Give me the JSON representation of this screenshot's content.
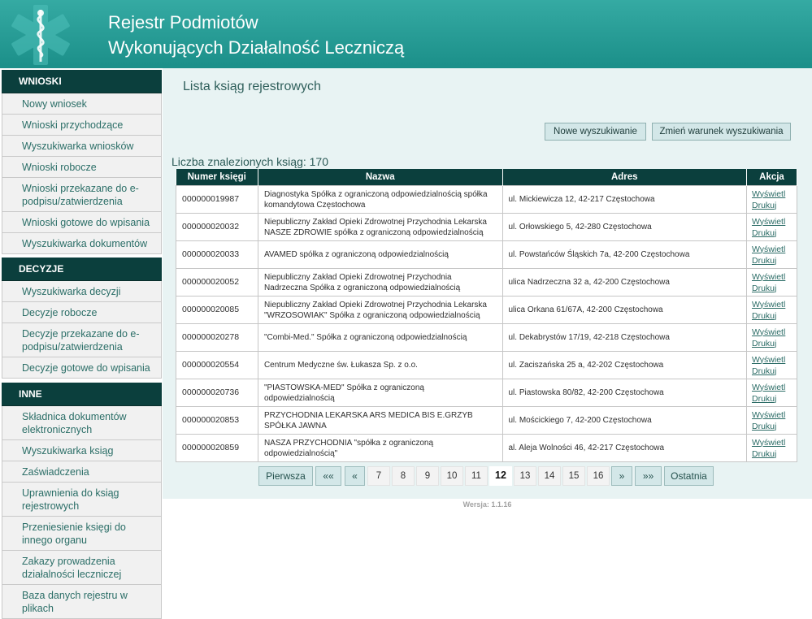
{
  "header": {
    "title_line1": "Rejestr Podmiotów",
    "title_line2": "Wykonujących Działalność Leczniczą"
  },
  "sidebar": {
    "sections": [
      {
        "title": "WNIOSKI",
        "items": [
          "Nowy wniosek",
          "Wnioski przychodzące",
          "Wyszukiwarka wniosków",
          "Wnioski robocze",
          "Wnioski przekazane do e-podpisu/zatwierdzenia",
          "Wnioski gotowe do wpisania",
          "Wyszukiwarka dokumentów"
        ]
      },
      {
        "title": "DECYZJE",
        "items": [
          "Wyszukiwarka decyzji",
          "Decyzje robocze",
          "Decyzje przekazane do e-podpisu/zatwierdzenia",
          "Decyzje gotowe do wpisania"
        ]
      },
      {
        "title": "INNE",
        "items": [
          "Składnica dokumentów elektronicznych",
          "Wyszukiwarka ksiąg",
          "Zaświadczenia",
          "Uprawnienia do ksiąg rejestrowych",
          "Przeniesienie księgi do innego organu",
          "Zakazy prowadzenia działalności leczniczej",
          "Baza danych rejestru w plikach"
        ]
      }
    ]
  },
  "main": {
    "page_title": "Lista ksiąg rejestrowych",
    "new_search_label": "Nowe wyszukiwanie",
    "change_search_label": "Zmień warunek wyszukiwania",
    "count_label": "Liczba znalezionych ksiąg: 170"
  },
  "table": {
    "headers": [
      "Numer księgi",
      "Nazwa",
      "Adres",
      "Akcja"
    ],
    "view_label": "Wyświetl",
    "print_label": "Drukuj",
    "rows": [
      {
        "number": "000000019987",
        "name": "Diagnostyka Spółka z ograniczoną odpowiedzialnością spółka komandytowa Częstochowa",
        "address": "ul. Mickiewicza 12, 42-217 Częstochowa"
      },
      {
        "number": "000000020032",
        "name": "Niepubliczny Zakład Opieki Zdrowotnej Przychodnia Lekarska NASZE ZDROWIE spółka z ograniczoną odpowiedzialnością",
        "address": "ul. Orłowskiego 5, 42-280 Częstochowa"
      },
      {
        "number": "000000020033",
        "name": "AVAMED spółka z ograniczoną odpowiedzialnością",
        "address": "ul. Powstańców Śląskich 7a, 42-200 Częstochowa"
      },
      {
        "number": "000000020052",
        "name": "Niepubliczny Zakład Opieki Zdrowotnej Przychodnia Nadrzeczna Spółka z ograniczoną odpowiedzialnością",
        "address": "ulica Nadrzeczna 32 a, 42-200 Częstochowa"
      },
      {
        "number": "000000020085",
        "name": "Niepubliczny Zakład Opieki Zdrowotnej Przychodnia Lekarska \"WRZOSOWIAK\" Spółka z ograniczoną odpowiedzialnością",
        "address": "ulica Orkana 61/67A, 42-200 Częstochowa"
      },
      {
        "number": "000000020278",
        "name": "\"Combi-Med.\" Spółka z ograniczoną odpowiedzialnością",
        "address": "ul. Dekabrystów 17/19, 42-218 Częstochowa"
      },
      {
        "number": "000000020554",
        "name": "Centrum Medyczne św. Łukasza Sp. z o.o.",
        "address": "ul. Zaciszańska 25 a, 42-202 Częstochowa"
      },
      {
        "number": "000000020736",
        "name": "\"PIASTOWSKA-MED\" Spółka z ograniczoną odpowiedzialnością",
        "address": "ul. Piastowska 80/82, 42-200 Częstochowa"
      },
      {
        "number": "000000020853",
        "name": "PRZYCHODNIA LEKARSKA ARS MEDICA BIS E.GRZYB SPÓŁKA JAWNA",
        "address": "ul. Mościckiego 7, 42-200 Częstochowa"
      },
      {
        "number": "000000020859",
        "name": "NASZA PRZYCHODNIA \"spółka z ograniczoną odpowiedzialnością\"",
        "address": "al. Aleja Wolności 46, 42-217 Częstochowa"
      }
    ]
  },
  "pagination": {
    "first": "Pierwsza",
    "prev_far": "««",
    "prev": "«",
    "pages": [
      "7",
      "8",
      "9",
      "10",
      "11",
      "12",
      "13",
      "14",
      "15",
      "16"
    ],
    "current": "12",
    "next": "»",
    "next_far": "»»",
    "last": "Ostatnia"
  },
  "footer": {
    "version": "Wersja: 1.1.16"
  },
  "colors": {
    "header": "#1b8f89",
    "dark_teal": "#0b3f3d",
    "main_bg": "#e8f3f3",
    "link": "#2a6b65"
  },
  "icons": {
    "logo": "star-of-life-caduceus-icon"
  }
}
